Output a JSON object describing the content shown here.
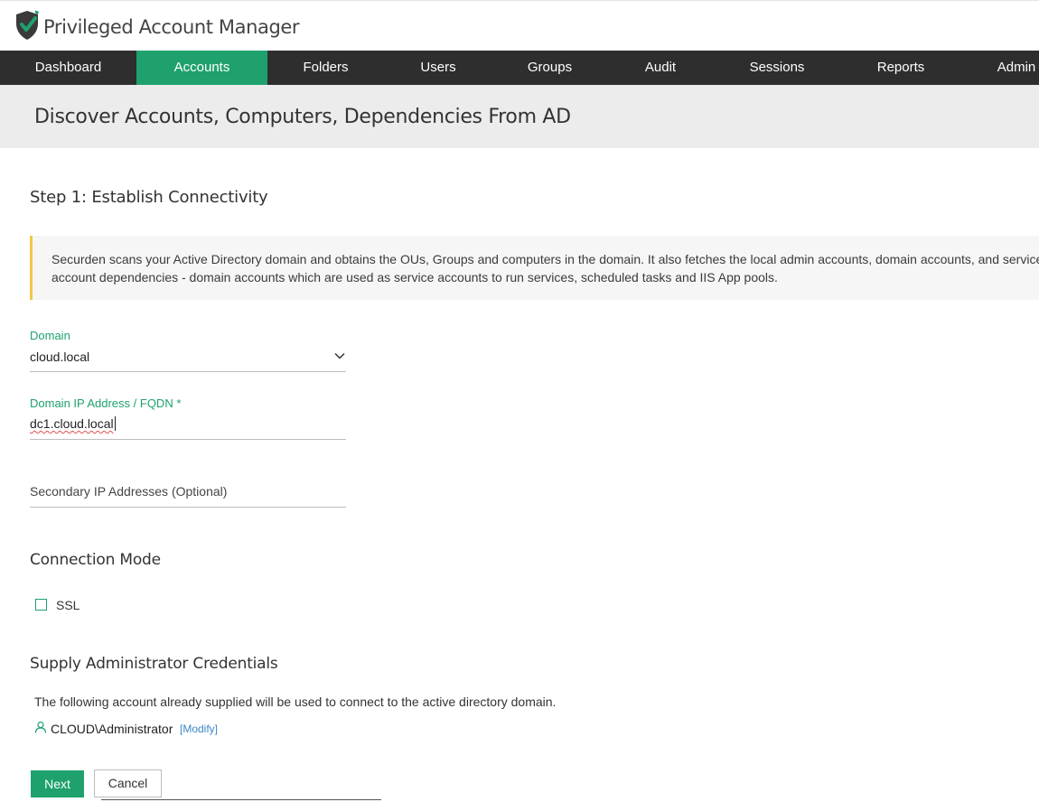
{
  "app": {
    "title": "Privileged Account Manager",
    "logo_icon": "shield-check-icon",
    "brand_color": "#1ea16c"
  },
  "nav": {
    "items": [
      {
        "label": "Dashboard",
        "active": false
      },
      {
        "label": "Accounts",
        "active": true
      },
      {
        "label": "Folders",
        "active": false
      },
      {
        "label": "Users",
        "active": false
      },
      {
        "label": "Groups",
        "active": false
      },
      {
        "label": "Audit",
        "active": false
      },
      {
        "label": "Sessions",
        "active": false
      },
      {
        "label": "Reports",
        "active": false
      },
      {
        "label": "Admin",
        "active": false
      }
    ]
  },
  "page": {
    "title": "Discover Accounts, Computers, Dependencies From AD"
  },
  "step": {
    "title": "Step 1: Establish Connectivity",
    "info": "Securden scans your Active Directory domain and obtains the OUs, Groups and computers in the domain. It also fetches the local admin accounts, domain accounts, and service account dependencies - domain accounts which are used as service accounts to run services, scheduled tasks and IIS App pools."
  },
  "form": {
    "domain": {
      "label": "Domain",
      "value": "cloud.local",
      "icon": "chevron-down-icon"
    },
    "domain_ip": {
      "label": "Domain IP Address / FQDN *",
      "value": "dc1.cloud.local"
    },
    "secondary_ip": {
      "placeholder": "Secondary IP Addresses (Optional)"
    }
  },
  "connection": {
    "title": "Connection Mode",
    "ssl_label": "SSL",
    "ssl_checked": false
  },
  "credentials": {
    "title": "Supply Administrator Credentials",
    "text": "The following account already supplied will be used to connect to the active directory domain.",
    "account": "CLOUD\\Administrator",
    "account_icon": "user-icon",
    "modify_label": "[Modify]"
  },
  "buttons": {
    "next": "Next",
    "cancel": "Cancel"
  }
}
